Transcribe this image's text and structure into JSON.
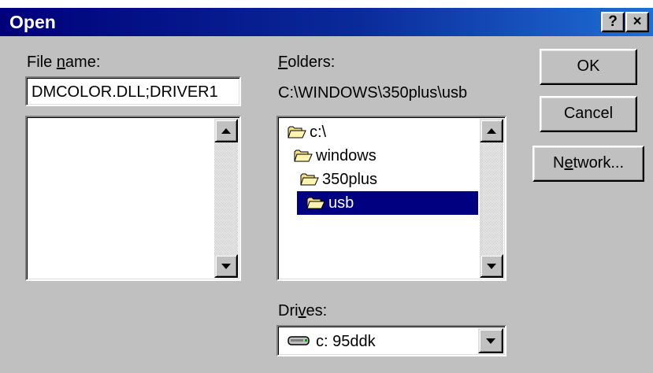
{
  "dialog": {
    "title": "Open",
    "help_glyph": "?",
    "close_glyph": "×"
  },
  "file_name": {
    "label_underlined": "n",
    "label_before": "File ",
    "label_after": "ame:",
    "value": "DMCOLOR.DLL;DRIVER1"
  },
  "folders": {
    "label_underlined": "F",
    "label_rest": "olders:",
    "current_path": "C:\\WINDOWS\\350plus\\usb",
    "tree": [
      {
        "label": "c:\\",
        "icon": "open-folder-icon",
        "selected": false
      },
      {
        "label": "windows",
        "icon": "open-folder-icon",
        "selected": false
      },
      {
        "label": "350plus",
        "icon": "open-folder-icon",
        "selected": false
      },
      {
        "label": "usb",
        "icon": "open-folder-icon",
        "selected": true
      }
    ]
  },
  "drives": {
    "label_before": "Dri",
    "label_underlined": "v",
    "label_after": "es:",
    "selected": "c: 95ddk",
    "icon": "hard-drive-icon"
  },
  "buttons": {
    "ok": "OK",
    "cancel": "Cancel",
    "network_before": "N",
    "network_underlined": "e",
    "network_after": "twork..."
  },
  "colors": {
    "title_bar_start": "#00007b",
    "title_bar_end": "#1f6fd6",
    "face": "#c0c0c0",
    "selection": "#000080"
  }
}
